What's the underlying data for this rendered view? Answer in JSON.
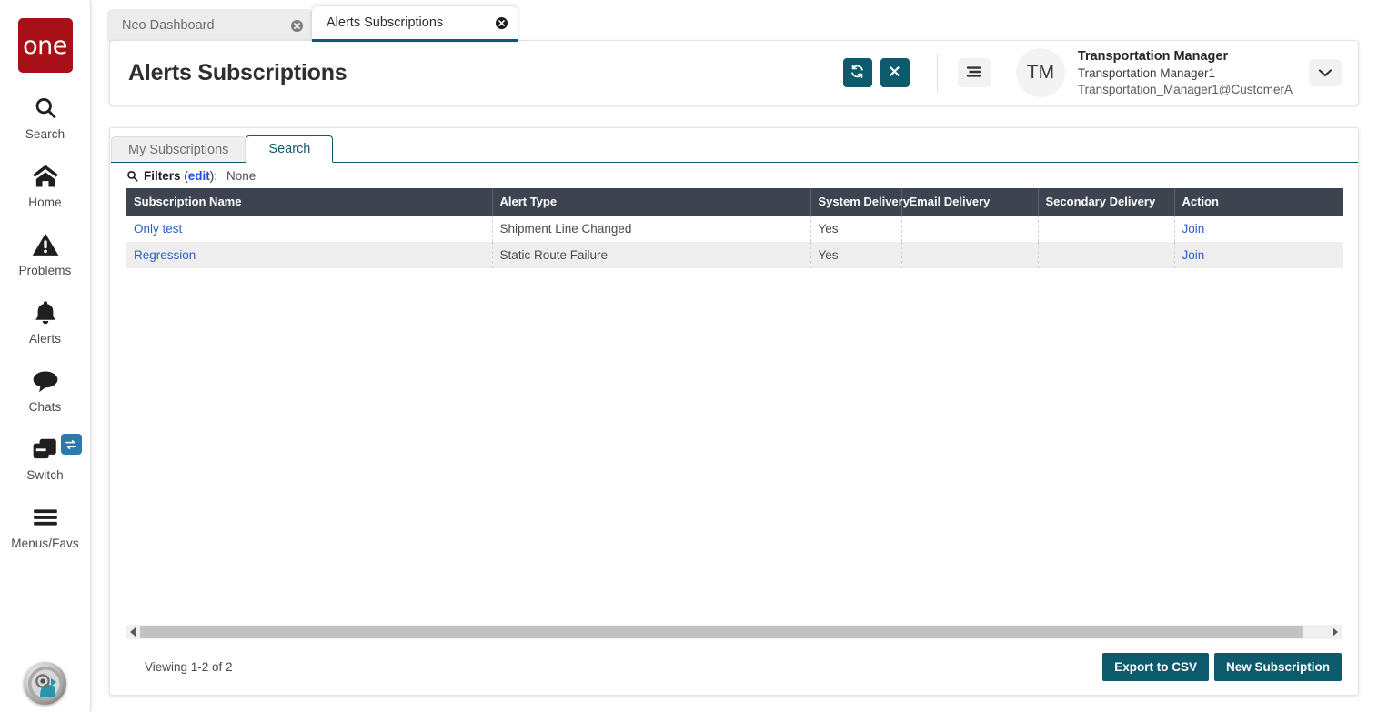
{
  "brand": {
    "logo_text": "one",
    "logo_color": "#a71016"
  },
  "theme": {
    "accent": "#0d5a6d",
    "header_row": "#3d444f",
    "link": "#2b5fcf",
    "badge_blue": "#2a7ab0"
  },
  "sidebar": {
    "items": [
      {
        "label": "Search",
        "icon": "search-icon"
      },
      {
        "label": "Home",
        "icon": "home-icon"
      },
      {
        "label": "Problems",
        "icon": "warning-triangle-icon"
      },
      {
        "label": "Alerts",
        "icon": "bell-icon"
      },
      {
        "label": "Chats",
        "icon": "chat-bubble-icon"
      },
      {
        "label": "Switch",
        "icon": "switch-windows-icon",
        "badge_icon": "swap-arrows-icon"
      },
      {
        "label": "Menus/Favs",
        "icon": "hamburger-icon"
      }
    ],
    "bottom_avatar_name": "assistant-avatar"
  },
  "browser_tabs": [
    {
      "title": "Neo Dashboard",
      "active": false,
      "close_icon": "close-circle-icon"
    },
    {
      "title": "Alerts Subscriptions",
      "active": true,
      "close_icon": "close-circle-icon"
    }
  ],
  "header": {
    "title": "Alerts Subscriptions",
    "refresh_icon": "refresh-icon",
    "close_icon": "close-x-icon",
    "menu_icon": "hamburger-menu-icon",
    "avatar_initials": "TM",
    "user_name": "Transportation Manager",
    "user_sub": "Transportation Manager1",
    "user_email": "Transportation_Manager1@CustomerA",
    "chevron_icon": "chevron-down-icon"
  },
  "tabs": [
    {
      "label": "My Subscriptions",
      "active": false
    },
    {
      "label": "Search",
      "active": true
    }
  ],
  "filters": {
    "icon": "magnifier-icon",
    "label": "Filters",
    "edit_label": "edit",
    "separator": ":",
    "value": "None"
  },
  "table": {
    "columns": [
      "Subscription Name",
      "Alert Type",
      "System Delivery",
      "Email Delivery",
      "Secondary Delivery",
      "Action"
    ],
    "rows": [
      {
        "subscription_name": "Only test",
        "alert_type": "Shipment Line Changed",
        "system_delivery": "Yes",
        "email_delivery": "",
        "secondary_delivery": "",
        "action": "Join"
      },
      {
        "subscription_name": "Regression",
        "alert_type": "Static Route Failure",
        "system_delivery": "Yes",
        "email_delivery": "",
        "secondary_delivery": "",
        "action": "Join"
      }
    ]
  },
  "scrollbar": {
    "left_arrow_icon": "arrow-left-icon",
    "right_arrow_icon": "arrow-right-icon"
  },
  "footer": {
    "viewing_text": "Viewing 1-2 of 2",
    "export_label": "Export to CSV",
    "new_subscription_label": "New Subscription"
  }
}
